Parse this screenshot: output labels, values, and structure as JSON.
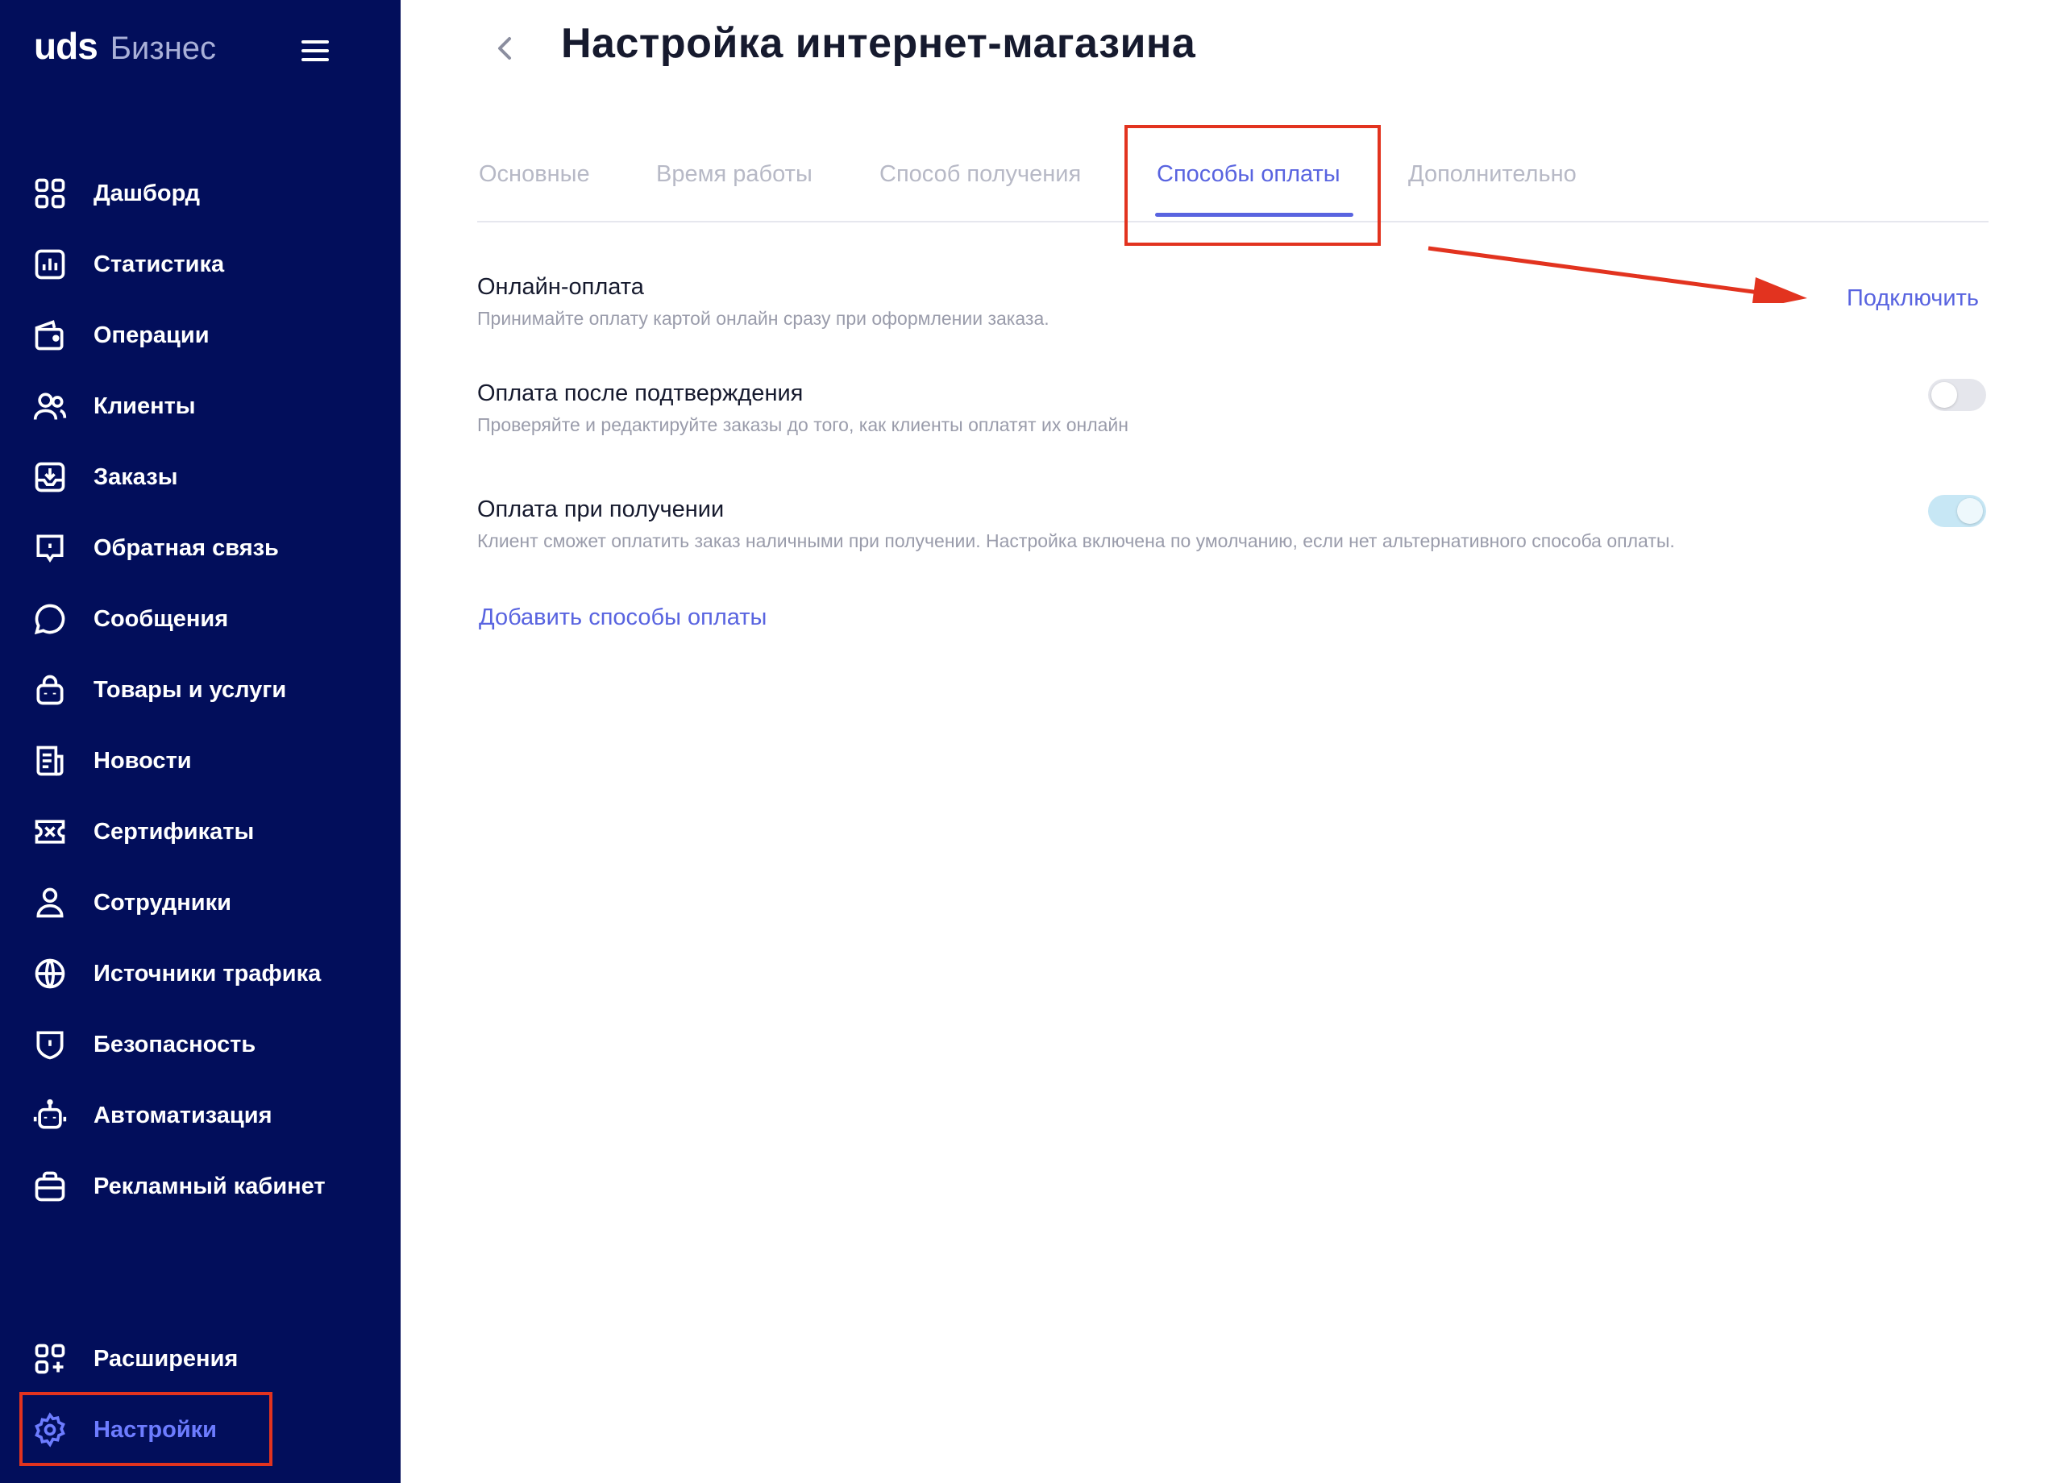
{
  "sidebar": {
    "logo_main": "uds",
    "logo_sub": "Бизнес",
    "items": [
      {
        "label": "Дашборд",
        "icon": "dashboard-icon"
      },
      {
        "label": "Статистика",
        "icon": "chart-icon"
      },
      {
        "label": "Операции",
        "icon": "wallet-icon"
      },
      {
        "label": "Клиенты",
        "icon": "users-icon"
      },
      {
        "label": "Заказы",
        "icon": "inbox-icon"
      },
      {
        "label": "Обратная связь",
        "icon": "feedback-icon"
      },
      {
        "label": "Сообщения",
        "icon": "chat-icon"
      },
      {
        "label": "Товары и услуги",
        "icon": "bag-icon"
      },
      {
        "label": "Новости",
        "icon": "news-icon"
      },
      {
        "label": "Сертификаты",
        "icon": "ticket-icon"
      },
      {
        "label": "Сотрудники",
        "icon": "person-icon"
      },
      {
        "label": "Источники трафика",
        "icon": "globe-icon"
      },
      {
        "label": "Безопасность",
        "icon": "shield-icon"
      },
      {
        "label": "Автоматизация",
        "icon": "robot-icon"
      },
      {
        "label": "Рекламный кабинет",
        "icon": "briefcase-icon"
      }
    ],
    "extensions": {
      "label": "Расширения",
      "icon": "apps-plus-icon"
    },
    "settings": {
      "label": "Настройки",
      "icon": "gear-icon",
      "active": true
    }
  },
  "header": {
    "title": "Настройка интернет-магазина"
  },
  "tabs": [
    {
      "label": "Основные"
    },
    {
      "label": "Время работы"
    },
    {
      "label": "Способ получения"
    },
    {
      "label": "Способы оплаты",
      "active": true
    },
    {
      "label": "Дополнительно"
    }
  ],
  "settings": {
    "online": {
      "title": "Онлайн-оплата",
      "description": "Принимайте оплату картой онлайн сразу при оформлении заказа.",
      "action": "Подключить"
    },
    "after_confirm": {
      "title": "Оплата после подтверждения",
      "description": "Проверяйте и редактируйте заказы до того, как клиенты оплатят их онлайн",
      "enabled": false
    },
    "on_receipt": {
      "title": "Оплата при получении",
      "description": "Клиент сможет оплатить заказ наличными при получении. Настройка включена по умолчанию, если нет альтернативного способа оплаты.",
      "enabled": true
    },
    "add_link": "Добавить способы оплаты"
  },
  "colors": {
    "sidebar_bg": "#020e5b",
    "accent": "#5964e0",
    "annotation": "#e2331f"
  }
}
